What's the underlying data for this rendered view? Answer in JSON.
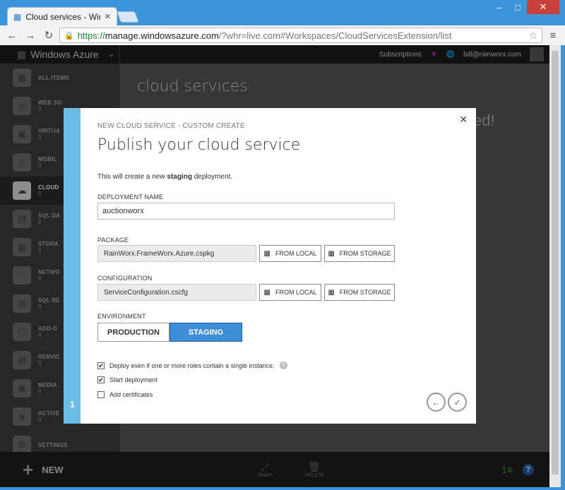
{
  "browser": {
    "tab_title": "Cloud services - Windows",
    "url_secure": "https://",
    "url_host": "manage.windowsazure.com",
    "url_path": "/?whr=live.com#Workspaces/CloudServicesExtension/list"
  },
  "portal": {
    "brand": "Windows Azure",
    "subscriptions": "Subscriptions",
    "user": "bill@rainworx.com",
    "content_title": "cloud services",
    "content_ghost": "ed!",
    "sidebar": [
      {
        "label": "ALL ITEMS",
        "count": ""
      },
      {
        "label": "WEB SO",
        "count": "0"
      },
      {
        "label": "VIRTUA",
        "count": "0"
      },
      {
        "label": "MOBIL",
        "count": "0"
      },
      {
        "label": "CLOUD",
        "count": "0"
      },
      {
        "label": "SQL DA",
        "count": "2"
      },
      {
        "label": "STORA",
        "count": "1"
      },
      {
        "label": "NETWO",
        "count": "0"
      },
      {
        "label": "SQL RE",
        "count": "0"
      },
      {
        "label": "ADD-O",
        "count": "0"
      },
      {
        "label": "SERVIC",
        "count": "0"
      },
      {
        "label": "MEDIA",
        "count": "0"
      },
      {
        "label": "ACTIVE",
        "count": "0"
      },
      {
        "label": "SETTINGS",
        "count": ""
      }
    ],
    "bottom": {
      "new_label": "NEW",
      "swap_label": "SWAP",
      "delete_label": "DELETE",
      "help": "?"
    }
  },
  "dialog": {
    "subtitle": "NEW CLOUD SERVICE - CUSTOM CREATE",
    "title": "Publish your cloud service",
    "info_pre": "This will create a new ",
    "info_bold": "staging",
    "info_post": " deployment.",
    "deployment_name_label": "DEPLOYMENT NAME",
    "deployment_name_value": "auctionworx",
    "package_label": "PACKAGE",
    "package_value": "RainWorx.FrameWorx.Azure.cspkg",
    "configuration_label": "CONFIGURATION",
    "configuration_value": "ServiceConfiguration.cscfg",
    "from_local": "FROM LOCAL",
    "from_storage": "FROM STORAGE",
    "environment_label": "ENVIRONMENT",
    "env_production": "PRODUCTION",
    "env_staging": "STAGING",
    "selected_environment": "STAGING",
    "checkboxes": [
      {
        "label": "Deploy even if one or more roles contain a single instance.",
        "checked": true
      },
      {
        "label": "Start deployment",
        "checked": true
      },
      {
        "label": "Add certificates",
        "checked": false
      }
    ],
    "step_number": "1"
  }
}
